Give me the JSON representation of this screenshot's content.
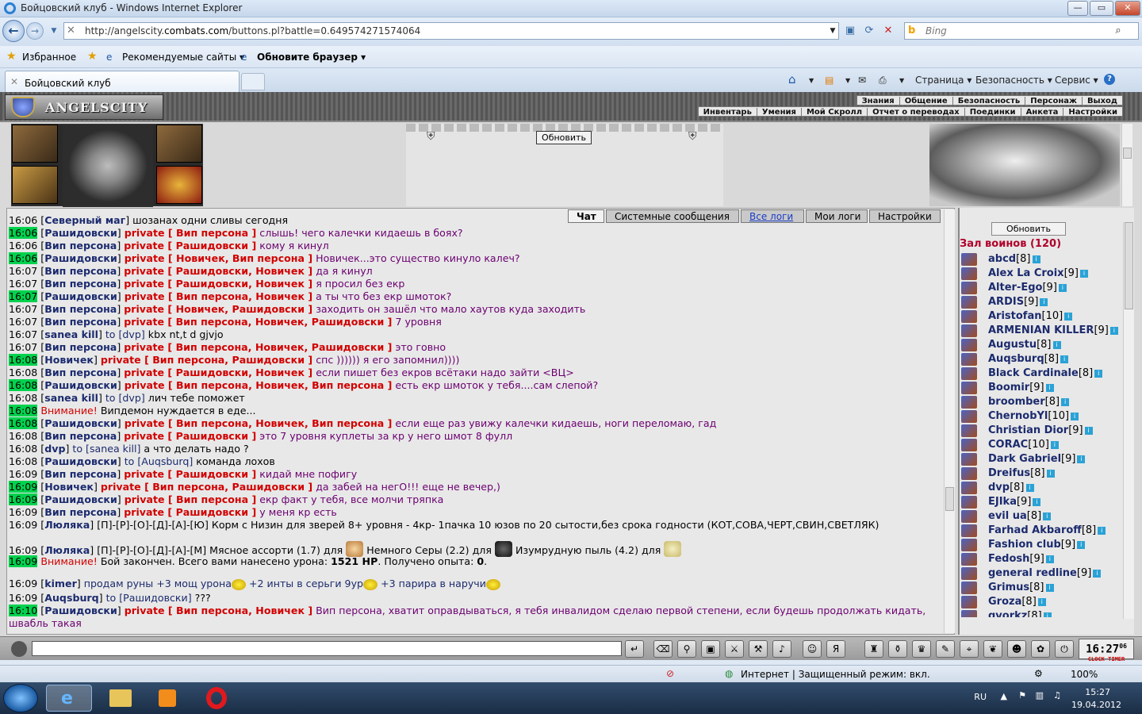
{
  "window": {
    "title": "Бойцовский клуб - Windows Internet Explorer",
    "min": "—",
    "max": "▭",
    "close": "✕"
  },
  "nav": {
    "url_prefix": "http://angelscity.",
    "url_domain": "combats.com",
    "url_suffix": "/buttons.pl?battle=0.649574271574064",
    "search_placeholder": "Bing"
  },
  "favorites": {
    "fav": "Избранное",
    "recommended": "Рекомендуемые сайты ▾",
    "update": "Обновите браузер ▾"
  },
  "tab": {
    "label": "Бойцовский клуб"
  },
  "commands": {
    "page": "Страница ▾",
    "security": "Безопасность ▾",
    "service": "Сервис ▾",
    "help": "?"
  },
  "game": {
    "logo": "ANGELSCITY",
    "menu_top": [
      "Знания",
      "Общение",
      "Безопасность",
      "Персонаж",
      "Выход"
    ],
    "menu_bottom": [
      "Инвентарь",
      "Умения",
      "Мой Скролл",
      "Отчет о переводах",
      "Поединки",
      "Анкета",
      "Настройки"
    ],
    "refresh": "Обновить",
    "chat_tabs": [
      "Чат",
      "Системные сообщения",
      "Все логи",
      "Мои логи",
      "Настройки"
    ]
  },
  "chat": [
    {
      "t": "16:06",
      "hl": false,
      "nick": "Северный маг",
      "msg": "шозанах одни сливы сегодня"
    },
    {
      "t": "16:06",
      "hl": true,
      "nick": "Рашидовски",
      "priv": "private [ Вип персона ]",
      "msg": "слышь! чего калечки кидаешь в боях?"
    },
    {
      "t": "16:06",
      "hl": false,
      "nick": "Вип персона",
      "priv": "private [ Рашидовски ]",
      "msg": "кому я кинул"
    },
    {
      "t": "16:06",
      "hl": true,
      "nick": "Рашидовски",
      "priv": "private [ Новичек, Вип персона ]",
      "msg": "Новичек...это существо кинуло калеч?"
    },
    {
      "t": "16:07",
      "hl": false,
      "nick": "Вип персона",
      "priv": "private [ Рашидовски, Новичек ]",
      "msg": "да я кинул"
    },
    {
      "t": "16:07",
      "hl": false,
      "nick": "Вип персона",
      "priv": "private [ Рашидовски, Новичек ]",
      "msg": "я просил без екр"
    },
    {
      "t": "16:07",
      "hl": true,
      "nick": "Рашидовски",
      "priv": "private [ Вип персона, Новичек ]",
      "msg": "а ты что без екр шмоток?"
    },
    {
      "t": "16:07",
      "hl": false,
      "nick": "Вип персона",
      "priv": "private [ Новичек, Рашидовски ]",
      "msg": "заходить он зашёл что мало хаутов куда заходить"
    },
    {
      "t": "16:07",
      "hl": false,
      "nick": "Вип персона",
      "priv": "private [ Вип персона, Новичек, Рашидовски ]",
      "msg": "7 уровня"
    },
    {
      "t": "16:07",
      "hl": false,
      "nick": "sanea kill",
      "to": "to [dvp]",
      "msg": "kbx nt,t d gjvjo"
    },
    {
      "t": "16:07",
      "hl": false,
      "nick": "Вип персона",
      "priv": "private [ Вип персона, Новичек, Рашидовски ]",
      "msg": "это говно"
    },
    {
      "t": "16:08",
      "hl": true,
      "nick": "Новичек",
      "priv": "private [ Вип персона, Рашидовски ]",
      "msg": "спс )))))) я его запомнил))))"
    },
    {
      "t": "16:08",
      "hl": false,
      "nick": "Вип персона",
      "priv": "private [ Рашидовски, Новичек ]",
      "msg": "если пишет без екров всётаки надо зайти <ВЦ>"
    },
    {
      "t": "16:08",
      "hl": true,
      "nick": "Рашидовски",
      "priv": "private [ Вип персона, Новичек, Вип персона ]",
      "msg": "есть екр шмоток у тебя....сам слепой?"
    },
    {
      "t": "16:08",
      "hl": false,
      "nick": "sanea kill",
      "to": "to [dvp]",
      "msg": "лич тебе поможет"
    },
    {
      "t": "16:08",
      "hl": true,
      "alert": "Внимание!",
      "msg": "Випдемон нуждается в еде..."
    },
    {
      "t": "16:08",
      "hl": true,
      "nick": "Рашидовски",
      "priv": "private [ Вип персона, Новичек, Вип персона ]",
      "msg": "если еще раз увижу калечки кидаешь, ноги переломаю, гад"
    },
    {
      "t": "16:08",
      "hl": false,
      "nick": "Вип персона",
      "priv": "private [ Рашидовски ]",
      "msg": "это 7 уровня куплеты за кр у него шмот 8 фулл"
    },
    {
      "t": "16:08",
      "hl": false,
      "nick": "dvp",
      "to": "to [sanea kill]",
      "msg": "а что делать надо ?"
    },
    {
      "t": "16:08",
      "hl": false,
      "nick": "Рашидовски",
      "to": "to [Auqsburq]",
      "msg": "команда лохов"
    },
    {
      "t": "16:09",
      "hl": false,
      "nick": "Вип персона",
      "priv": "private [ Рашидовски ]",
      "msg": "кидай мне пофигу"
    },
    {
      "t": "16:09",
      "hl": true,
      "nick": "Новичек",
      "priv": "private [ Вип персона, Рашидовски ]",
      "msg": "да забей на негО!!! еще не вечер,)"
    },
    {
      "t": "16:09",
      "hl": true,
      "nick": "Рашидовски",
      "priv": "private [ Вип персона ]",
      "msg": "екр факт у тебя, все молчи тряпка"
    },
    {
      "t": "16:09",
      "hl": false,
      "nick": "Вип персона",
      "priv": "private [ Рашидовски ]",
      "msg": "у меня кр есть"
    },
    {
      "t": "16:09",
      "hl": false,
      "nick": "Люляка",
      "msg": "[П]-[Р]-[О]-[Д]-[А]-[Ю] Корм с Низин для зверей 8+ уровня - 4кр- 1пачка 10 юзов по 20 сытости,без срока годности (КОТ,СОВА,ЧЕРТ,СВИН,СВЕТЛЯК)"
    }
  ],
  "chat_extra": {
    "l26_time": "16:09",
    "l26_nick": "Люляка",
    "l26_a": "[П]-[Р]-[О]-[Д]-[А]-[М] Мясное ассорти (1.7) для",
    "l26_b": "Немного Серы (2.2) для",
    "l26_c": "Изумрудную пыль (4.2) для",
    "l27_time": "16:09",
    "l27_alert": "Внимание!",
    "l27_msg1": "Бой закончен. Всего вами нанесено урона:",
    "l27_dmg": "1521 HP",
    "l27_msg2": ". Получено опыта:",
    "l27_exp": "0",
    "l28_time": "16:09",
    "l28_nick": "kimer",
    "l28_a": "продам руны +3 мощ урона",
    "l28_b": "+2 инты в серьги 9ур",
    "l28_c": "+3 парира в наручи",
    "l29_time": "16:09",
    "l29_nick": "Auqsburq",
    "l29_to": "to [Рашидовски]",
    "l29_msg": "???",
    "l30_time": "16:10",
    "l30_nick": "Рашидовски",
    "l30_priv": "private [ Вип персона, Новичек ]",
    "l30_msg": "Вип персона, хватит оправдываться, я тебя инвалидом сделаю первой степени, если будешь продолжать кидать, швабль такая"
  },
  "room": {
    "refresh": "Обновить",
    "title": "Зал воинов (120)"
  },
  "users": [
    {
      "n": "abcd",
      "l": "[8]"
    },
    {
      "n": "Alex La Croix",
      "l": "[9]"
    },
    {
      "n": "Alter-Ego",
      "l": "[9]"
    },
    {
      "n": "ARDIS",
      "l": "[9]"
    },
    {
      "n": "Aristofan",
      "l": "[10]"
    },
    {
      "n": "ARMENIAN KILLER",
      "l": "[9]"
    },
    {
      "n": "Augustu",
      "l": "[8]"
    },
    {
      "n": "Auqsburq",
      "l": "[8]"
    },
    {
      "n": "Black Cardinale",
      "l": "[8]"
    },
    {
      "n": "Boomir",
      "l": "[9]"
    },
    {
      "n": "broomber",
      "l": "[8]"
    },
    {
      "n": "ChernobYl",
      "l": "[10]"
    },
    {
      "n": "Christian Dior",
      "l": "[9]"
    },
    {
      "n": "CORAC",
      "l": "[10]"
    },
    {
      "n": "Dark Gabriel",
      "l": "[9]"
    },
    {
      "n": "Dreifus",
      "l": "[8]"
    },
    {
      "n": "dvp",
      "l": "[8]"
    },
    {
      "n": "EJIka",
      "l": "[9]"
    },
    {
      "n": "evil ua",
      "l": "[8]"
    },
    {
      "n": "Farhad Akbaroff",
      "l": "[8]"
    },
    {
      "n": "Fashion club",
      "l": "[9]"
    },
    {
      "n": "Fedosh",
      "l": "[9]"
    },
    {
      "n": "general redline",
      "l": "[9]"
    },
    {
      "n": "Grimus",
      "l": "[8]"
    },
    {
      "n": "Groza",
      "l": "[8]"
    },
    {
      "n": "gvorkz",
      "l": "[8]"
    }
  ],
  "clock": {
    "time": "16:27",
    "sec": "06",
    "label": "CLOCK TIMER"
  },
  "status": {
    "zone": "Интернет | Защищенный режим: вкл.",
    "zoom": "100%"
  },
  "taskbar": {
    "lang": "RU",
    "time": "15:27",
    "date": "19.04.2012"
  }
}
